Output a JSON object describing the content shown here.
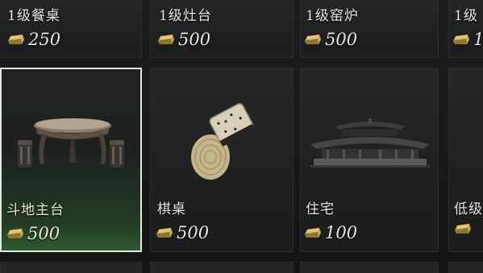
{
  "top_row": [
    {
      "name": "1级餐桌",
      "price": "250"
    },
    {
      "name": "1级灶台",
      "price": "500"
    },
    {
      "name": "1级窑炉",
      "price": "500"
    },
    {
      "name": "1级",
      "price": "1"
    }
  ],
  "main_row": [
    {
      "name": "斗地主台",
      "price": "500",
      "icon": "table-stools-icon",
      "selected": true
    },
    {
      "name": "棋桌",
      "price": "500",
      "icon": "chess-board-icon",
      "selected": false
    },
    {
      "name": "住宅",
      "price": "100",
      "icon": "house-icon",
      "selected": false
    },
    {
      "name": "低级",
      "price": "",
      "icon": "",
      "selected": false
    }
  ],
  "colors": {
    "selected_border": "#e6e6e2",
    "selected_glow": "#2d5a2f",
    "text": "#e9e5dc",
    "coin": "#c9a54b"
  },
  "currency_icon": "gold-ingot-icon"
}
